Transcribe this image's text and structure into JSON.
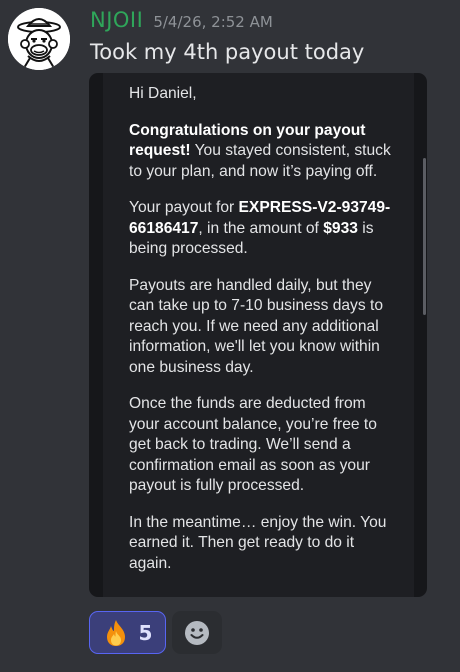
{
  "message": {
    "username": "NJOII",
    "timestamp": "5/4/26, 2:52 AM",
    "text": "Took my 4th payout today"
  },
  "email": {
    "greeting": "Hi Daniel,",
    "para1_bold": "Congratulations on your payout request!",
    "para1_rest": " You stayed consistent, stuck to your plan, and now it’s paying off.",
    "para2_pre": "Your payout for ",
    "para2_account": "EXPRESS-V2-93749-66186417",
    "para2_mid": ", in the amount of ",
    "para2_amount": "$933",
    "para2_post": " is being processed.",
    "para3": "Payouts are handled daily, but they can take up to 7-10 business days to reach you. If we need any additional information, we'll let you know within one business day.",
    "para4": "Once the funds are deducted from your account balance, you’re free to get back to trading. We’ll send a confirmation email as soon as your payout is fully processed.",
    "para5": "In the meantime… enjoy the win. You earned it. Then get ready to do it again."
  },
  "reactions": [
    {
      "icon": "fire-emoji-icon",
      "count": "5"
    }
  ],
  "add_reaction_icon": "smiley-face-icon",
  "colors": {
    "background": "#313338",
    "username": "#2fa65a",
    "timestamp": "#8e9297",
    "reaction_border": "#5865f2",
    "reaction_bg": "#3b3f7a"
  }
}
